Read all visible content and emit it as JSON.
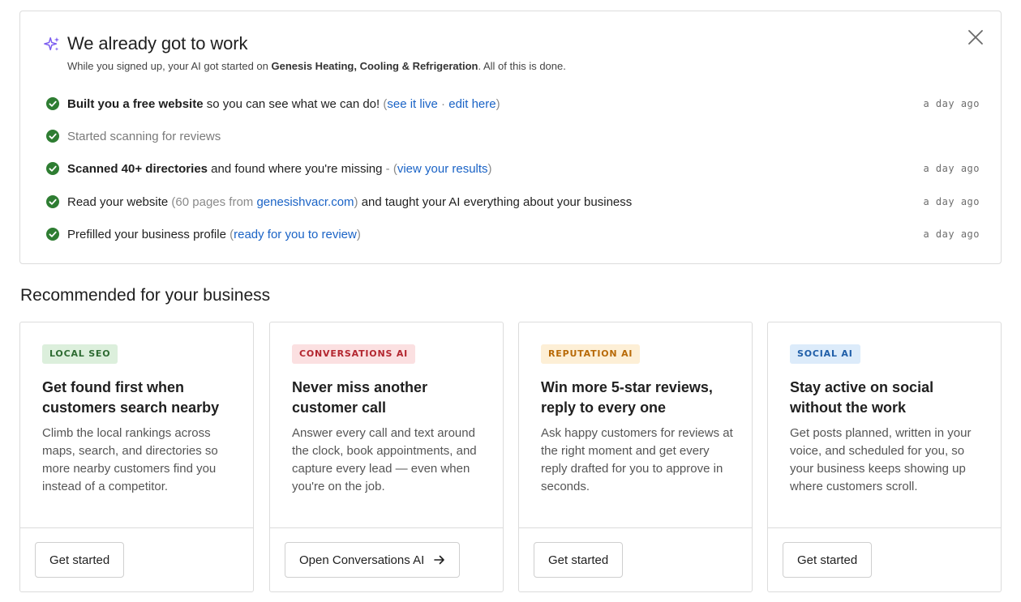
{
  "work": {
    "title": "We already got to work",
    "subtitle_pre": "While you signed up, your AI got started on ",
    "business_name": "Genesis Heating, Cooling & Refrigeration",
    "subtitle_post": ". All of this is done.",
    "tasks": [
      {
        "bold": "Built you a free website",
        "text": " so you can see what we can do! ",
        "open": "(",
        "link1": "see it live",
        "sep": " · ",
        "link2": "edit here",
        "close": ")",
        "time": "a day ago"
      },
      {
        "text": "Started scanning for reviews"
      },
      {
        "bold": "Scanned 40+ directories",
        "text": " and found where you're missing ",
        "dash": "- ",
        "open": "(",
        "link1": "view your results",
        "close": ")",
        "time": "a day ago"
      },
      {
        "text": "Read your website ",
        "open": "(60 pages from ",
        "link1": "genesishvacr.com",
        "close": ")",
        "text2": " and taught your AI everything about your business",
        "time": "a day ago"
      },
      {
        "text": "Prefilled your business profile ",
        "open": "(",
        "link1": "ready for you to review",
        "close": ")",
        "time": "a day ago"
      }
    ]
  },
  "recommended": {
    "title": "Recommended for your business",
    "cards": [
      {
        "badge": "LOCAL SEO",
        "title": "Get found first when customers search nearby",
        "desc": "Climb the local rankings across maps, search, and directories so more nearby customers find you instead of a competitor.",
        "cta": "Get started"
      },
      {
        "badge": "CONVERSATIONS AI",
        "title": "Never miss another customer call",
        "desc": "Answer every call and text around the clock, book appointments, and capture every lead — even when you're on the job.",
        "cta": "Open Conversations AI"
      },
      {
        "badge": "REPUTATION AI",
        "title": "Win more 5-star reviews, reply to every one",
        "desc": "Ask happy customers for reviews at the right moment and get every reply drafted for you to approve in seconds.",
        "cta": "Get started"
      },
      {
        "badge": "SOCIAL AI",
        "title": "Stay active on social without the work",
        "desc": "Get posts planned, written in your voice, and scheduled for you, so your business keeps showing up where customers scroll.",
        "cta": "Get started"
      }
    ]
  },
  "colors": {
    "link": "#1a63c6",
    "check": "#2e7d32",
    "sparkle": "#7b5cf0",
    "badge_green": "#dcefdc",
    "badge_red": "#fbe0e1",
    "badge_orange": "#fdefd6",
    "badge_blue": "#dcebfa"
  },
  "icons": [
    "sparkle-icon",
    "close-icon",
    "check-circle-icon",
    "arrow-right-icon"
  ]
}
